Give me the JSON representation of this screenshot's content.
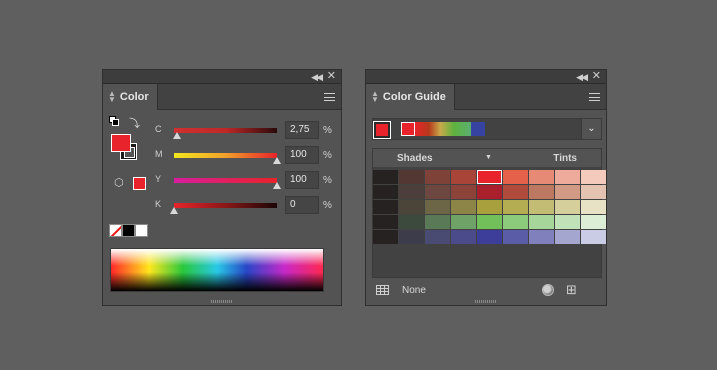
{
  "color_panel": {
    "title": "Color",
    "sliders": [
      {
        "label": "C",
        "value": "2,75",
        "pct": "%",
        "level": 0.0275,
        "gradient": [
          "#ffffff",
          "#e8232b",
          "#8b1c1c"
        ],
        "track": [
          "#d03030",
          "#c02828",
          "#2a0a0a"
        ]
      },
      {
        "label": "M",
        "value": "100",
        "pct": "%",
        "level": 1.0,
        "track": [
          "#f2e81e",
          "#f0a02a",
          "#e8232b"
        ]
      },
      {
        "label": "Y",
        "value": "100",
        "pct": "%",
        "level": 1.0,
        "track": [
          "#d81ea0",
          "#e02060",
          "#e8232b"
        ]
      },
      {
        "label": "K",
        "value": "0",
        "pct": "%",
        "level": 0.0,
        "track": [
          "#e8232b",
          "#8a1818",
          "#1a0505"
        ]
      }
    ],
    "fill_color": "#e8232b",
    "stroke_color": "#1a1a1a"
  },
  "guide_panel": {
    "title": "Color Guide",
    "base_color": "#e8232b",
    "shades_label": "Shades",
    "tints_label": "Tints",
    "footer_label": "None",
    "grid": [
      [
        "#262222",
        "#523733",
        "#7e4238",
        "#a84538",
        "#e8232b",
        "#e5614a",
        "#e78a75",
        "#eeab9b",
        "#f4cabd"
      ],
      [
        "#262222",
        "#4c3f3b",
        "#6c4840",
        "#8c443a",
        "#a91f2c",
        "#b04b3c",
        "#bd7861",
        "#d09a85",
        "#e5c3b3"
      ],
      [
        "#262222",
        "#4a4538",
        "#6c6647",
        "#8d8547",
        "#a8a03c",
        "#b5ad52",
        "#c3bc75",
        "#d4cf9b",
        "#e7e2c5"
      ],
      [
        "#262222",
        "#3c4a3d",
        "#5a7a57",
        "#6ea267",
        "#72c05a",
        "#8ccb7b",
        "#a6d69a",
        "#c1e2b9",
        "#ddeed6"
      ],
      [
        "#262222",
        "#3d3c4a",
        "#4a4b72",
        "#4b4b8c",
        "#3c3e9a",
        "#5a5ca8",
        "#8080bc",
        "#a5a6d0",
        "#cacbe4"
      ]
    ]
  }
}
